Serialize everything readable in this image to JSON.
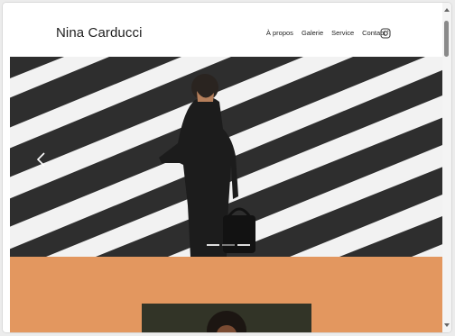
{
  "site": {
    "brand": "Nina Carducci"
  },
  "nav": {
    "items": [
      "À propos",
      "Galerie",
      "Service",
      "Contact"
    ],
    "social_icon": "instagram-icon"
  },
  "hero": {
    "slide_count": 3,
    "active_slide_index": 1,
    "prev_icon": "chevron-left-icon"
  },
  "colors": {
    "accent": "#e3975f",
    "text": "#1f1f1f"
  }
}
